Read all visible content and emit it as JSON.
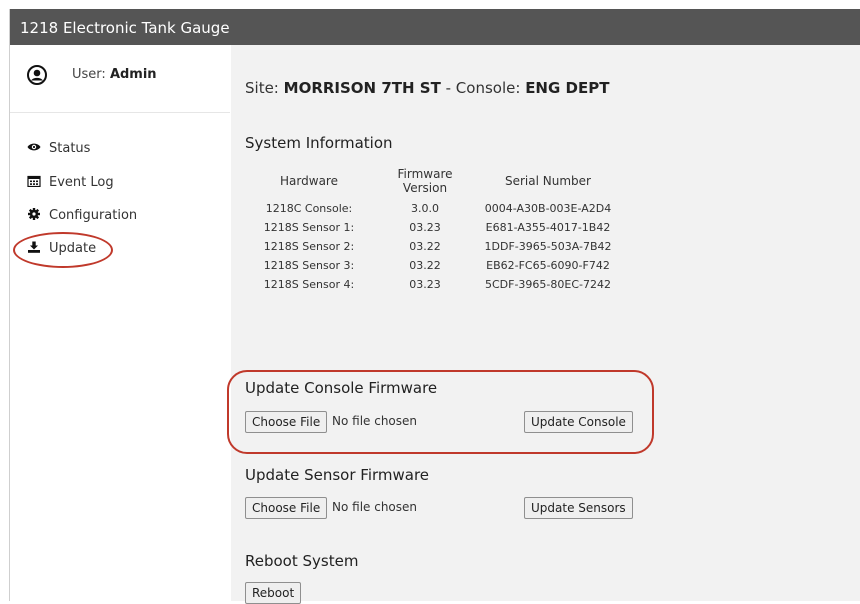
{
  "app": {
    "title": "1218 Electronic Tank Gauge"
  },
  "user": {
    "label": "User:",
    "name": "Admin"
  },
  "nav": {
    "items": [
      {
        "label": "Status",
        "icon": "eye-icon"
      },
      {
        "label": "Event Log",
        "icon": "calendar-icon"
      },
      {
        "label": "Configuration",
        "icon": "gear-icon"
      },
      {
        "label": "Update",
        "icon": "download-icon"
      }
    ]
  },
  "site": {
    "site_label": "Site:",
    "site_value": "MORRISON 7TH ST",
    "sep": "-",
    "console_label": "Console:",
    "console_value": "ENG DEPT"
  },
  "system_info": {
    "title": "System Information",
    "headers": {
      "hardware": "Hardware",
      "firmware_line1": "Firmware",
      "firmware_line2": "Version",
      "serial": "Serial Number"
    },
    "rows": [
      {
        "hardware": "1218C Console:",
        "firmware": "3.0.0",
        "serial": "0004-A30B-003E-A2D4"
      },
      {
        "hardware": "1218S Sensor 1:",
        "firmware": "03.23",
        "serial": "E681-A355-4017-1B42"
      },
      {
        "hardware": "1218S Sensor 2:",
        "firmware": "03.22",
        "serial": "1DDF-3965-503A-7B42"
      },
      {
        "hardware": "1218S Sensor 3:",
        "firmware": "03.22",
        "serial": "EB62-FC65-6090-F742"
      },
      {
        "hardware": "1218S Sensor 4:",
        "firmware": "03.23",
        "serial": "5CDF-3965-80EC-7242"
      }
    ]
  },
  "console_fw": {
    "title": "Update Console Firmware",
    "choose": "Choose File",
    "no_file": "No file chosen",
    "update": "Update Console"
  },
  "sensor_fw": {
    "title": "Update Sensor Firmware",
    "choose": "Choose File",
    "no_file": "No file chosen",
    "update": "Update Sensors"
  },
  "reboot": {
    "title": "Reboot System",
    "button": "Reboot"
  },
  "colors": {
    "header_bg": "#555555",
    "main_bg": "#f2f2f2",
    "highlight": "#c0392b"
  }
}
